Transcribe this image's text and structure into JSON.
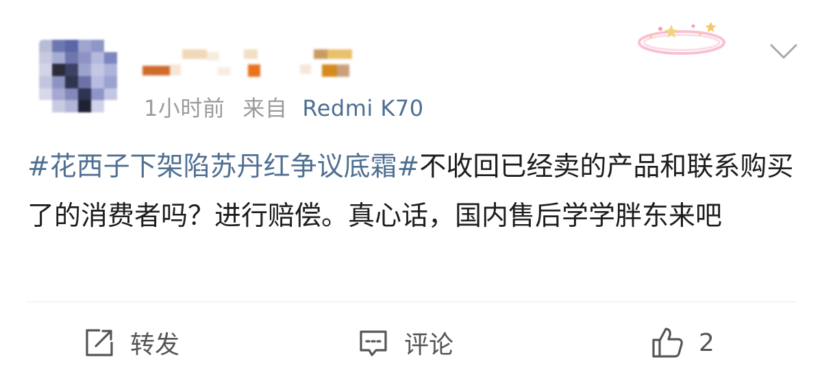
{
  "post": {
    "author": {
      "name": "",
      "avatar": "blurred-avatar"
    },
    "meta": {
      "time": "1小时前",
      "source_prefix": "来自",
      "device": "Redmi K70"
    },
    "content": {
      "hashtag": "#花西子下架陷苏丹红争议底霜#",
      "text": "不收回已经卖的产品和联系购买了的消费者吗？进行赔偿。真心话，国内售后学学胖东来吧"
    },
    "actions": {
      "repost_label": "转发",
      "comment_label": "评论",
      "like_count": "2"
    }
  },
  "icons": {
    "menu": "chevron-down-icon",
    "repost": "repost-icon",
    "comment": "comment-icon",
    "like": "thumbs-up-icon",
    "decoration": "sparkle-halo-icon"
  },
  "colors": {
    "link": "#4f6f92",
    "meta": "#9a9a9a",
    "body_text": "#1d1d1d",
    "action": "#555555"
  }
}
